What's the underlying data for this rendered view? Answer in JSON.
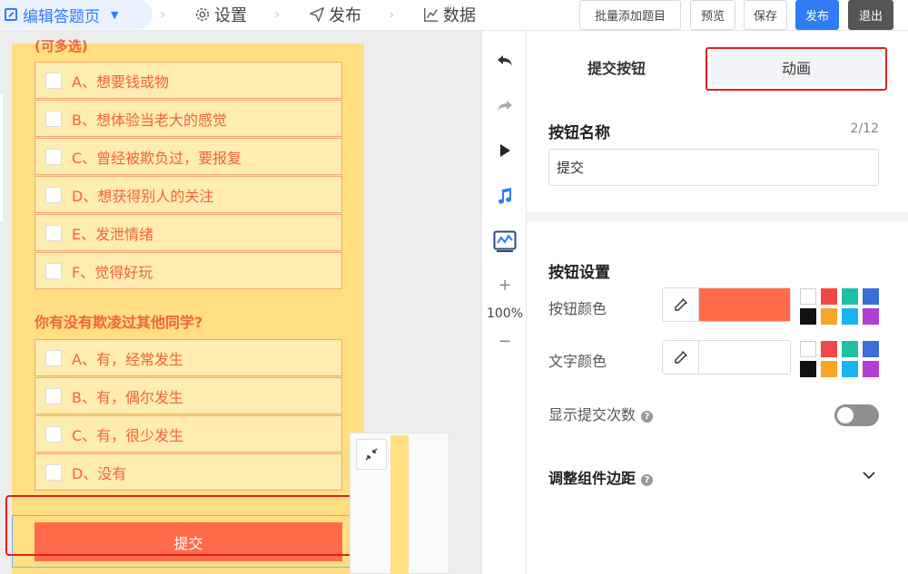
{
  "topbar": {
    "edit_page": "编辑答题页",
    "settings": "设置",
    "publish_nav": "发布",
    "data": "数据",
    "batch_add": "批量添加题目",
    "preview": "预览",
    "save": "保存",
    "publish": "发布",
    "exit": "退出"
  },
  "canvas": {
    "question1_partial": "(可多选)",
    "question1_options": [
      "A、想要钱或物",
      "B、想体验当老大的感觉",
      "C、曾经被欺负过，要报复",
      "D、想获得别人的关注",
      "E、发泄情绪",
      "F、觉得好玩"
    ],
    "question2_title": "你有没有欺凌过其他同学?",
    "question2_options": [
      "A、有，经常发生",
      "B、有，偶尔发生",
      "C、有，很少发生",
      "D、没有"
    ],
    "submit": "提交"
  },
  "toolbar": {
    "zoom": "100%",
    "zoom_in": "+",
    "zoom_out": "−"
  },
  "panel": {
    "tab_submit": "提交按钮",
    "tab_animation": "动画",
    "button_name_label": "按钮名称",
    "char_count": "2/12",
    "button_name_value": "提交",
    "button_settings": "按钮设置",
    "button_color_label": "按钮颜色",
    "text_color_label": "文字颜色",
    "show_submit_count": "显示提交次数",
    "adjust_margin": "调整组件边距",
    "help_glyph": "?",
    "button_color": "#ff6b4a",
    "text_color": "#ffffff",
    "swatches": [
      "#ffffff",
      "#f04848",
      "#1fbfa5",
      "#3a6ed8",
      "#111111",
      "#f5a623",
      "#18b4f0",
      "#b13fd3"
    ],
    "show_count_enabled": false
  }
}
